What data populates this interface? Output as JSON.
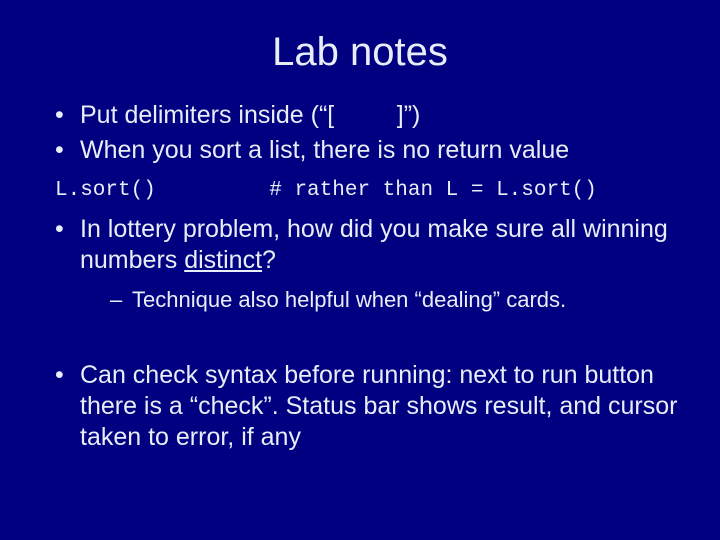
{
  "title": "Lab notes",
  "bullets": {
    "b1": "Put delimiters inside (“[         ]”)",
    "b2": "When you sort a list, there is no return value",
    "code": "L.sort()         # rather than L = L.sort()",
    "b3a": "In lottery problem, how did you make sure all winning numbers ",
    "b3_underlined": "distinct",
    "b3b": "?",
    "sub1": "Technique also helpful when “dealing” cards.",
    "b4": "Can check syntax before running:  next to run button there is a “check”.  Status bar shows result, and cursor taken to error, if any"
  }
}
